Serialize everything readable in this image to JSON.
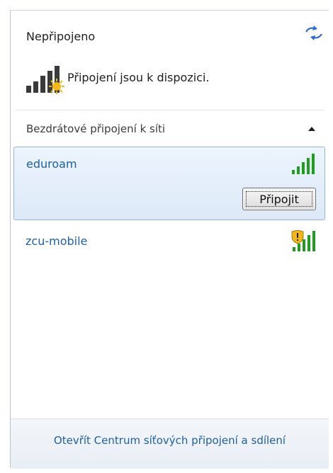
{
  "header": {
    "status": "Nepřipojeno",
    "available_text": "Připojení jsou k dispozici."
  },
  "section": {
    "label": "Bezdrátové připojení k síti"
  },
  "networks": [
    {
      "name": "eduroam",
      "signal_bars": 5,
      "secured_warning": false,
      "connect_label": "Připojit"
    },
    {
      "name": "zcu-mobile",
      "signal_bars": 5,
      "secured_warning": true
    }
  ],
  "footer": {
    "link": "Otevřít Centrum síťových připojení a sdílení"
  },
  "colors": {
    "link_blue": "#1f5fa8",
    "signal_green": "#1f9d1f",
    "selection_border": "#92b6de"
  }
}
